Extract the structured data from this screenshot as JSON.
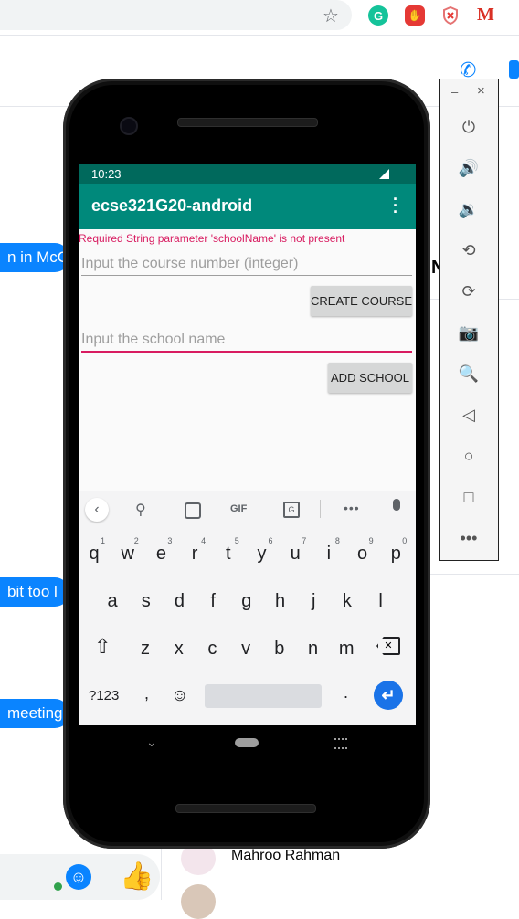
{
  "browser": {
    "icons": [
      "star-icon",
      "grammarly-icon",
      "adblock-icon",
      "shield-icon",
      "gmail-icon"
    ],
    "grammarly_letter": "G",
    "gmail_letter": "M"
  },
  "messenger": {
    "bubbles": [
      "n in McCo",
      "bit too l",
      "meeting"
    ],
    "contact_name": "Mahroo Rahman",
    "partial_letter": "N"
  },
  "phone": {
    "status_time": "10:23",
    "app_title": "ecse321G20-android",
    "error_text": "Required String parameter 'schoolName' is not present",
    "course_placeholder": "Input the course number (integer)",
    "create_course_label": "CREATE COURSE",
    "school_placeholder": "Input the school name",
    "add_school_label": "ADD SCHOOL",
    "keyboard": {
      "toolbar_gif": "GIF",
      "row1": [
        "q",
        "w",
        "e",
        "r",
        "t",
        "y",
        "u",
        "i",
        "o",
        "p"
      ],
      "row1_hints": [
        "1",
        "2",
        "3",
        "4",
        "5",
        "6",
        "7",
        "8",
        "9",
        "0"
      ],
      "row2": [
        "a",
        "s",
        "d",
        "f",
        "g",
        "h",
        "j",
        "k",
        "l"
      ],
      "row3": [
        "z",
        "x",
        "c",
        "v",
        "b",
        "n",
        "m"
      ],
      "symbols_key": "?123",
      "comma_key": ",",
      "period_key": "."
    }
  },
  "emulator_panel": {
    "minimize": "–",
    "close": "×",
    "controls": [
      "power-icon",
      "volume-up-icon",
      "volume-down-icon",
      "rotate-left-icon",
      "rotate-right-icon",
      "camera-icon",
      "zoom-icon",
      "back-icon",
      "home-icon",
      "overview-icon",
      "more-icon"
    ]
  },
  "colors": {
    "app_bar": "#00897b",
    "status_bar": "#00695c",
    "accent": "#d81b60",
    "messenger_blue": "#0a84ff"
  }
}
